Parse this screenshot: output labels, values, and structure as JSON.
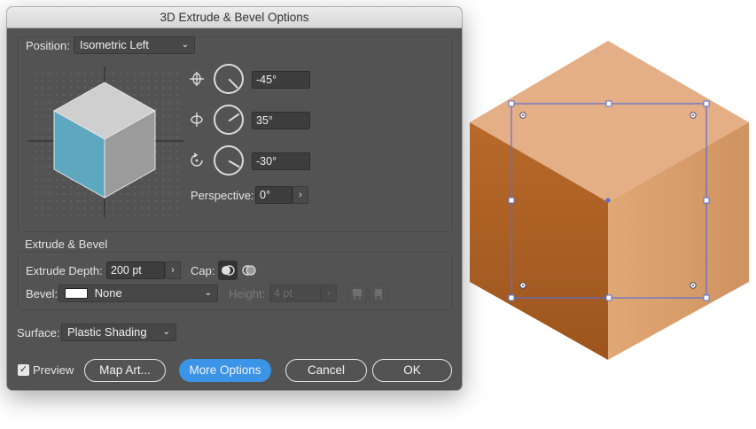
{
  "window": {
    "title": "3D Extrude & Bevel Options"
  },
  "position": {
    "label": "Position:",
    "selected": "Isometric Left",
    "x_rotation": "-45°",
    "y_rotation": "35°",
    "z_rotation": "-30°",
    "perspective_label": "Perspective:",
    "perspective_value": "0°"
  },
  "extrude_bevel": {
    "section_label": "Extrude & Bevel",
    "depth_label": "Extrude Depth:",
    "depth_value": "200 pt",
    "cap_label": "Cap:",
    "bevel_label": "Bevel:",
    "bevel_value": "None",
    "height_label": "Height:",
    "height_value": "4 pt"
  },
  "surface": {
    "label": "Surface:",
    "selected": "Plastic Shading"
  },
  "footer": {
    "preview_label": "Preview",
    "preview_checked": true,
    "map_art_label": "Map Art...",
    "more_options_label": "More Options",
    "cancel_label": "Cancel",
    "ok_label": "OK"
  },
  "colors": {
    "dialog_bg": "#535353",
    "accent": "#3b94e6",
    "cube_top": "#e4af86",
    "cube_left": "#a35b22",
    "cube_right": "#d59a67",
    "selection": "#5a6fd6",
    "preview_left": "#5da7bf",
    "preview_top": "#cfcfcf",
    "preview_right": "#9b9b9b"
  }
}
